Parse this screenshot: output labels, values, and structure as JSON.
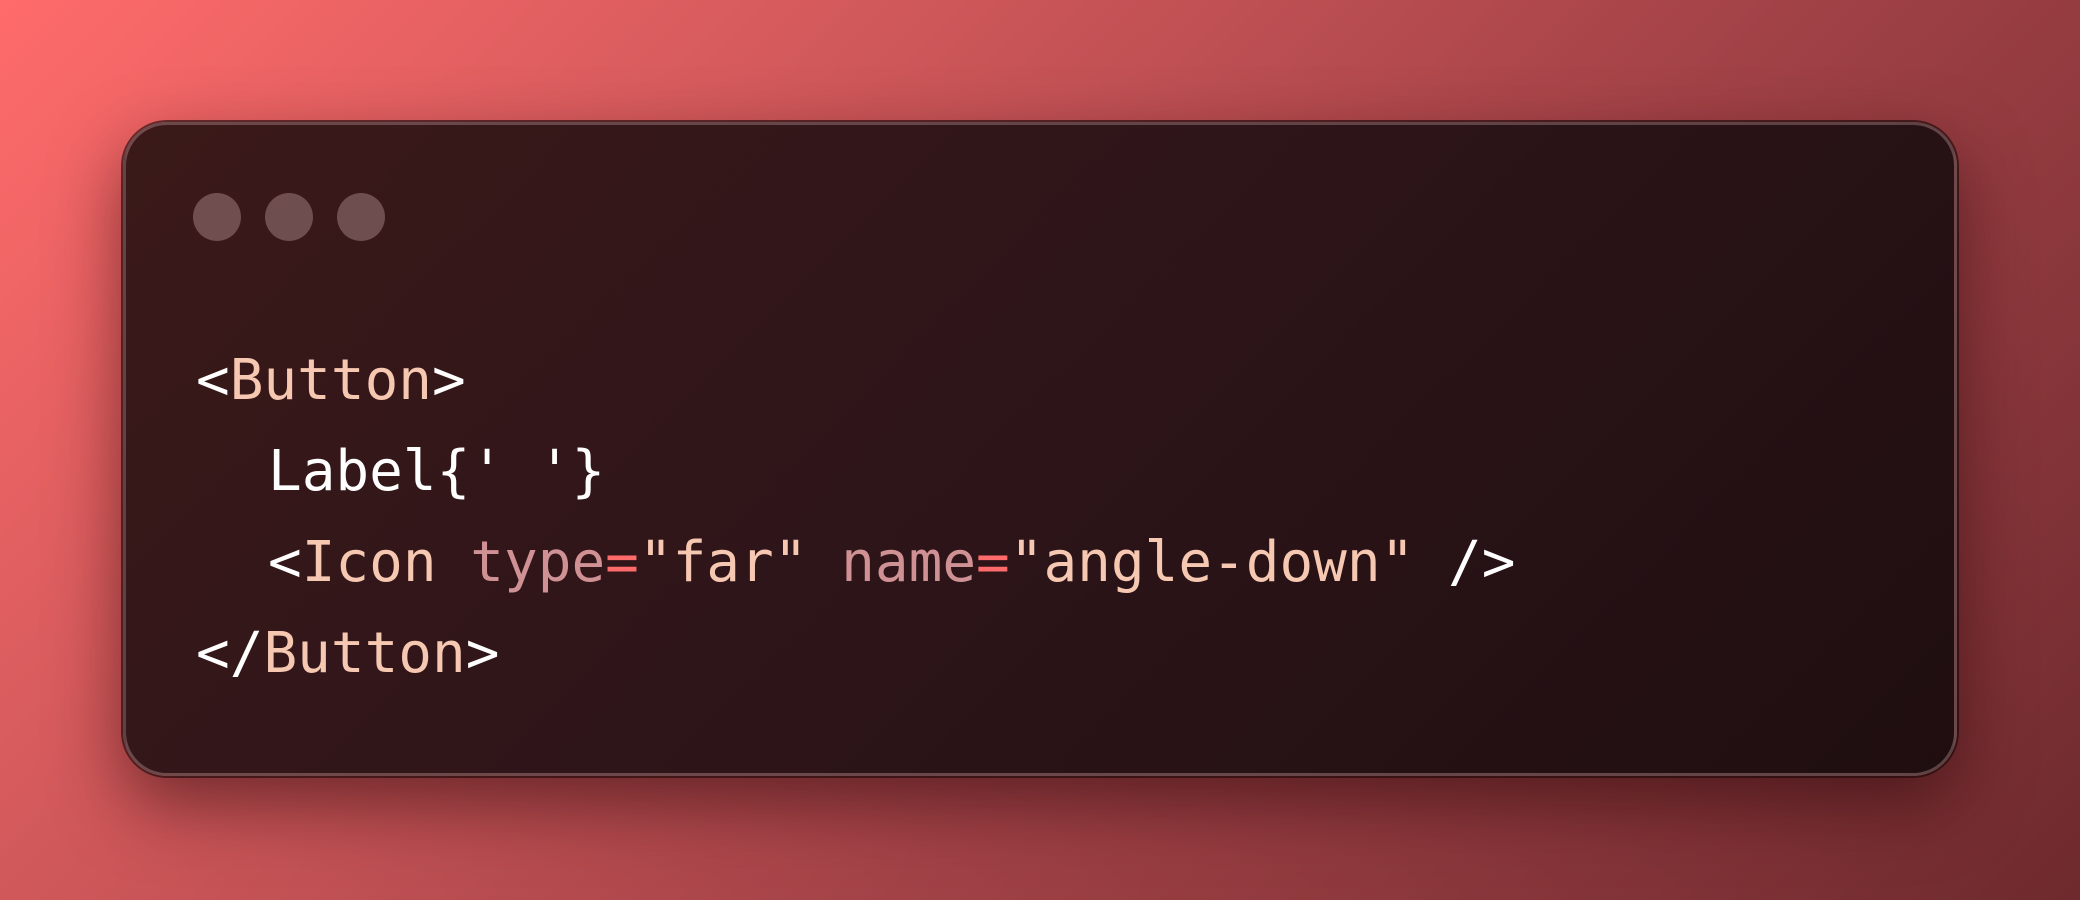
{
  "code": {
    "line1": {
      "open": "<",
      "tag": "Button",
      "close": ">"
    },
    "line2": {
      "label": "Label",
      "expression": "{' '}"
    },
    "line3": {
      "open": "<",
      "tag": "Icon",
      "attr1_name": "type",
      "attr1_eq": "=",
      "attr1_value": "\"far\"",
      "attr2_name": "name",
      "attr2_eq": "=",
      "attr2_value": "\"angle-down\"",
      "self_close": "/>"
    },
    "line4": {
      "open": "</",
      "tag": "Button",
      "close": ">"
    }
  },
  "colors": {
    "background_start": "#ff6b6b",
    "background_end": "#6e2a2e",
    "window": "#2e1519",
    "tag": "#f6c7b1",
    "attribute": "#d09195",
    "equals": "#ff6b6b",
    "string": "#f6c7b1",
    "punctuation": "#ffffff"
  }
}
